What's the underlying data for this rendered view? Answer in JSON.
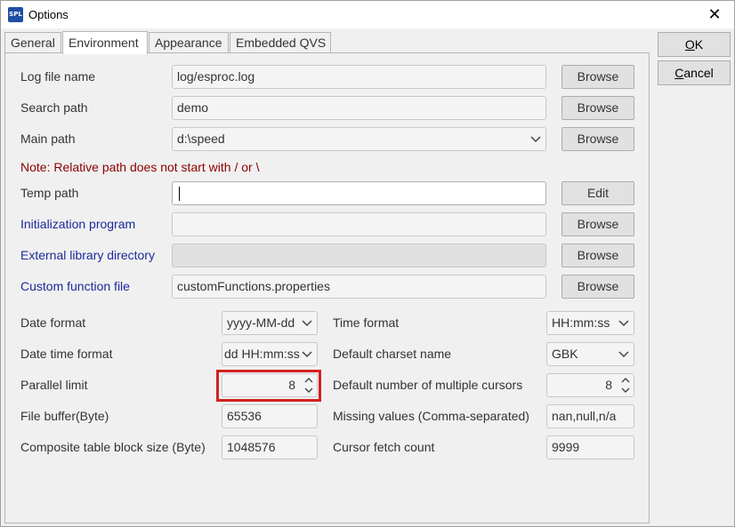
{
  "window": {
    "app_icon_text": "SPL",
    "title": "Options",
    "close_symbol": "✕"
  },
  "tabs": [
    {
      "label": "General"
    },
    {
      "label": "Environment",
      "active": true
    },
    {
      "label": "Appearance"
    },
    {
      "label": "Embedded QVS"
    }
  ],
  "buttons": {
    "ok_prefix": "",
    "ok_underlined": "O",
    "ok_rest": "K",
    "cancel_underlined": "C",
    "cancel_rest": "ancel"
  },
  "paths": {
    "log_file_name": {
      "label": "Log file name",
      "value": "log/esproc.log",
      "button": "Browse"
    },
    "search_path": {
      "label": "Search path",
      "value": "demo",
      "button": "Browse"
    },
    "main_path": {
      "label": "Main path",
      "value": "d:\\speed",
      "button": "Browse"
    },
    "note": "Note: Relative path does not start with / or \\",
    "temp_path": {
      "label": "Temp path",
      "value": "",
      "button": "Edit"
    },
    "init_program": {
      "label": "Initialization program",
      "value": "",
      "button": "Browse"
    },
    "ext_lib_dir": {
      "label": "External library directory",
      "value": "",
      "button": "Browse"
    },
    "custom_func_file": {
      "label": "Custom function file",
      "value": "customFunctions.properties",
      "button": "Browse"
    }
  },
  "settings": {
    "date_format": {
      "label": "Date format",
      "value": "yyyy-MM-dd"
    },
    "time_format": {
      "label": "Time format",
      "value": "HH:mm:ss"
    },
    "date_time_format": {
      "label": "Date time format",
      "value": "dd HH:mm:ss"
    },
    "default_charset": {
      "label": "Default charset name",
      "value": "GBK"
    },
    "parallel_limit": {
      "label": "Parallel limit",
      "value": "8"
    },
    "multi_cursors": {
      "label": "Default number of multiple cursors",
      "value": "8"
    },
    "file_buffer": {
      "label": "File buffer(Byte)",
      "value": "65536"
    },
    "missing_values": {
      "label": "Missing values (Comma-separated)",
      "value": "nan,null,n/a"
    },
    "block_size": {
      "label": "Composite table block size (Byte)",
      "value": "1048576"
    },
    "cursor_fetch": {
      "label": "Cursor fetch count",
      "value": "9999"
    }
  },
  "colors": {
    "blue_label": "#1a2a9a",
    "note_red": "#8b0000",
    "highlight_red": "#d42020"
  }
}
